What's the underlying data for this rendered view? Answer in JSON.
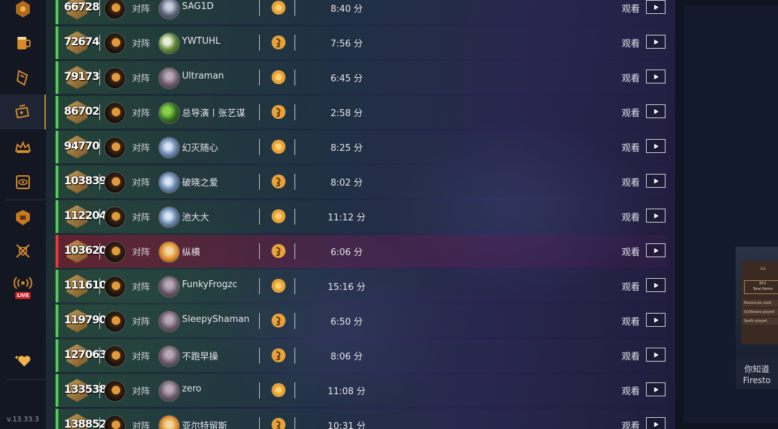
{
  "sidebar": {
    "items": [
      {
        "icon": "rank-emblem-icon"
      },
      {
        "icon": "tavern-mug-icon"
      },
      {
        "icon": "hearthstone-card-icon"
      },
      {
        "icon": "match-history-icon",
        "active": true
      },
      {
        "icon": "crown-icon"
      },
      {
        "icon": "eye-card-icon"
      },
      {
        "icon": "arena-helmet-icon"
      },
      {
        "icon": "crossed-swords-shield-icon"
      },
      {
        "icon": "live-stream-icon",
        "badge": "LIVE"
      },
      {
        "icon": "sparkle-heart-icon"
      }
    ],
    "version": "v.13.33.3",
    "accent_color": "#c88a2a"
  },
  "matches": {
    "vs_label": "对阵",
    "watch_label": "观看",
    "rows": [
      {
        "rank": "66728",
        "opponent": "SAG1D",
        "turn": "first",
        "duration": "8:40 分",
        "result": "win"
      },
      {
        "rank": "72674",
        "opponent": "YWTUHL",
        "turn": "second",
        "duration": "7:56 分",
        "result": "win"
      },
      {
        "rank": "79173",
        "opponent": "Ultraman",
        "turn": "first",
        "duration": "6:45 分",
        "result": "win"
      },
      {
        "rank": "86702",
        "opponent": "总导演丨张艺谋",
        "turn": "second",
        "duration": "2:58 分",
        "result": "win"
      },
      {
        "rank": "94770",
        "opponent": "幻灭随心",
        "turn": "first",
        "duration": "8:25 分",
        "result": "win"
      },
      {
        "rank": "103839",
        "opponent": "破晓之爱",
        "turn": "second",
        "duration": "8:02 分",
        "result": "win"
      },
      {
        "rank": "112204",
        "opponent": "池大大",
        "turn": "first",
        "duration": "11:12 分",
        "result": "win"
      },
      {
        "rank": "103620",
        "opponent": "纵横",
        "turn": "second",
        "duration": "6:06 分",
        "result": "loss"
      },
      {
        "rank": "111610",
        "opponent": "FunkyFrogzc",
        "turn": "first",
        "duration": "15:16 分",
        "result": "win"
      },
      {
        "rank": "119790",
        "opponent": "SleepyShaman",
        "turn": "second",
        "duration": "6:50 分",
        "result": "win"
      },
      {
        "rank": "127063",
        "opponent": "不跑早操",
        "turn": "second",
        "duration": "8:06 分",
        "result": "win"
      },
      {
        "rank": "133538",
        "opponent": "zero",
        "turn": "first",
        "duration": "11:08 分",
        "result": "win"
      },
      {
        "rank": "138852",
        "opponent": "亚尔特留斯",
        "turn": "second",
        "duration": "10:31 分",
        "result": "win"
      }
    ],
    "colors": {
      "win": "#4fcf52",
      "loss": "#e23c3c",
      "coin": "#e8a23a"
    }
  },
  "tip": {
    "line1": "你知道",
    "line2": "Firesto",
    "preview": {
      "header": "Lo",
      "points_value": "E53",
      "points_label": "Total Points",
      "rows": [
        "Resources used",
        "Quillboars played",
        "Spells played"
      ]
    }
  }
}
